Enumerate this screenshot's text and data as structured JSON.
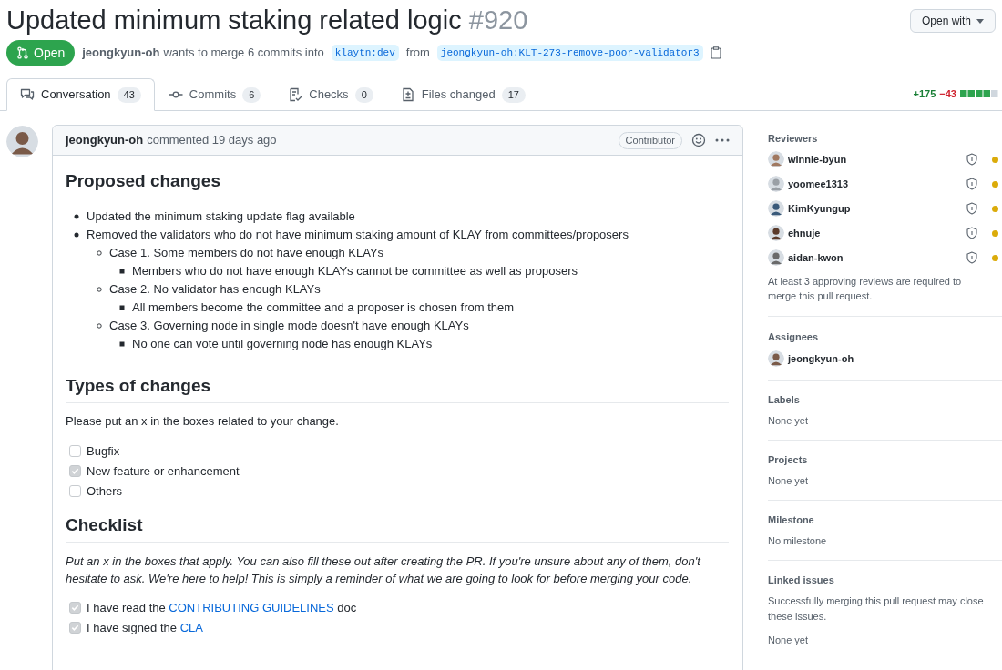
{
  "title": "Updated minimum staking related logic",
  "number": "#920",
  "open_with": "Open with",
  "state": {
    "kind": "open",
    "label": "Open"
  },
  "meta": {
    "author": "jeongkyun-oh",
    "text": "wants to merge 6 commits into",
    "base": "klaytn:dev",
    "from": "from",
    "head": "jeongkyun-oh:KLT-273-remove-poor-validator3"
  },
  "tabs": [
    {
      "label": "Conversation",
      "count": "43",
      "selected": true,
      "kind": "conversation"
    },
    {
      "label": "Commits",
      "count": "6",
      "selected": false,
      "kind": "commits"
    },
    {
      "label": "Checks",
      "count": "0",
      "selected": false,
      "kind": "checks"
    },
    {
      "label": "Files changed",
      "count": "17",
      "selected": false,
      "kind": "files"
    }
  ],
  "diffstat": {
    "additions": "+175",
    "deletions": "−43",
    "blocks": [
      {
        "kind": "added"
      },
      {
        "kind": "added"
      },
      {
        "kind": "added"
      },
      {
        "kind": "added"
      },
      {
        "kind": "neutral"
      }
    ]
  },
  "comment": {
    "author": "jeongkyun-oh",
    "action": "commented 19 days ago",
    "badge": "Contributor",
    "body": [
      {
        "kind": "heading",
        "text": "Proposed changes"
      },
      {
        "kind": "list",
        "items": [
          {
            "text": "Updated the minimum staking update flag available"
          },
          {
            "text": "Removed the validators who do not have minimum staking amount of KLAY from committees/proposers",
            "children": [
              {
                "text": "Case 1. Some members do not have enough KLAYs",
                "children": [
                  {
                    "text": "Members who do not have enough KLAYs cannot be committee as well as proposers"
                  }
                ]
              },
              {
                "text": "Case 2. No validator has enough KLAYs",
                "children": [
                  {
                    "text": "All members become the committee and a proposer is chosen from them"
                  }
                ]
              },
              {
                "text": "Case 3. Governing node in single mode doesn't have enough KLAYs",
                "children": [
                  {
                    "text": "No one can vote until governing node has enough KLAYs"
                  }
                ]
              }
            ]
          }
        ]
      },
      {
        "kind": "heading",
        "text": "Types of changes"
      },
      {
        "kind": "paragraph",
        "text": "Please put an x in the boxes related to your change."
      },
      {
        "kind": "tasks",
        "items": [
          {
            "text": "Bugfix",
            "checked": false
          },
          {
            "text": "New feature or enhancement",
            "checked": true
          },
          {
            "text": "Others",
            "checked": false
          }
        ]
      },
      {
        "kind": "heading",
        "text": "Checklist"
      },
      {
        "kind": "note",
        "text": "Put an x in the boxes that apply. You can also fill these out after creating the PR. If you're unsure about any of them, don't hesitate to ask. We're here to help! This is simply a reminder of what we are going to look for before merging your code."
      },
      {
        "kind": "tasks",
        "items": [
          {
            "text": "I have read the ",
            "link": "CONTRIBUTING GUIDELINES",
            "after": " doc",
            "checked": true
          },
          {
            "text": "I have signed the ",
            "link": "CLA",
            "checked": true
          }
        ]
      }
    ]
  },
  "sidebar": {
    "reviewers": {
      "title": "Reviewers",
      "items": [
        {
          "name": "winnie-byun",
          "color": "#dbab0a"
        },
        {
          "name": "yoomee1313",
          "color": "#dbab0a"
        },
        {
          "name": "KimKyungup",
          "color": "#dbab0a"
        },
        {
          "name": "ehnuje",
          "color": "#dbab0a"
        },
        {
          "name": "aidan-kwon",
          "color": "#dbab0a"
        }
      ],
      "note": "At least 3 approving reviews are required to merge this pull request."
    },
    "assignees": {
      "title": "Assignees",
      "items": [
        {
          "name": "jeongkyun-oh"
        }
      ]
    },
    "sections": [
      {
        "title": "Labels",
        "value": "None yet"
      },
      {
        "title": "Projects",
        "value": "None yet"
      },
      {
        "title": "Milestone",
        "value": "No milestone"
      },
      {
        "title": "Linked issues",
        "note": "Successfully merging this pull request may close these issues.",
        "value": "None yet"
      }
    ]
  }
}
